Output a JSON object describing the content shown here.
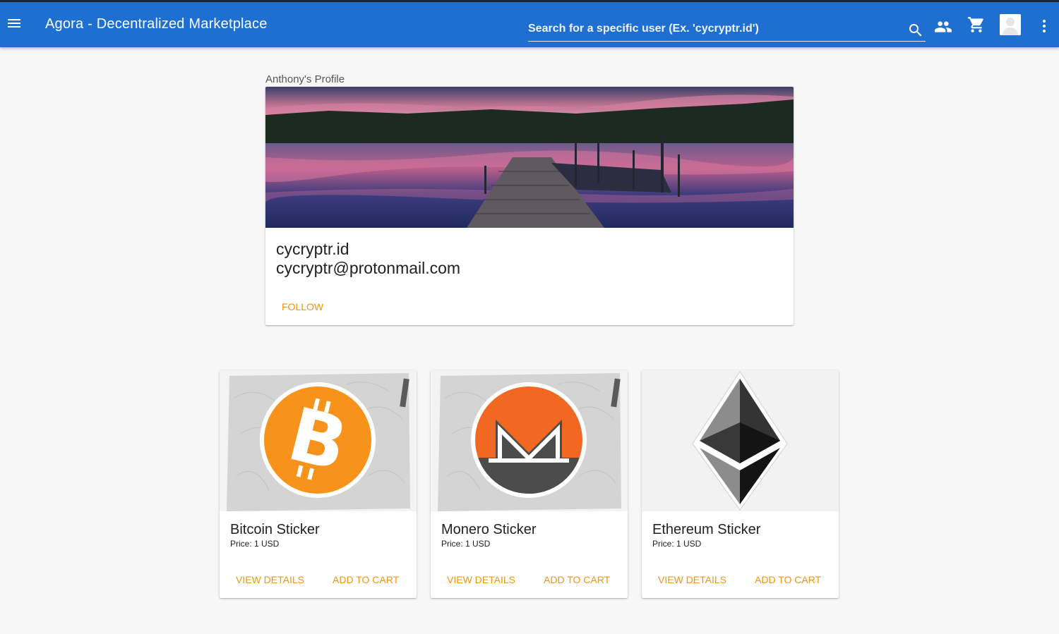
{
  "app": {
    "title": "Agora - Decentralized Marketplace"
  },
  "search": {
    "placeholder": "Search for a specific user (Ex. 'cycryptr.id')",
    "value": ""
  },
  "header_icons": [
    "menu-icon",
    "search-icon",
    "people-icon",
    "shopping-cart-icon",
    "avatar",
    "more-vert-icon"
  ],
  "profile": {
    "label": "Anthony's Profile",
    "username": "cycryptr.id",
    "email": "cycryptr@protonmail.com",
    "follow_label": "FOLLOW"
  },
  "products": [
    {
      "name": "Bitcoin Sticker",
      "price": "Price: 1 USD",
      "details_label": "VIEW DETAILS",
      "cart_label": "ADD TO CART",
      "icon": "bitcoin-logo"
    },
    {
      "name": "Monero Sticker",
      "price": "Price: 1 USD",
      "details_label": "VIEW DETAILS",
      "cart_label": "ADD TO CART",
      "icon": "monero-logo"
    },
    {
      "name": "Ethereum Sticker",
      "price": "Price: 1 USD",
      "details_label": "VIEW DETAILS",
      "cart_label": "ADD TO CART",
      "icon": "ethereum-logo"
    }
  ],
  "colors": {
    "app_bar": "#1e6fcf",
    "accent": "#f29412",
    "bitcoin": "#f7931a",
    "monero_orange": "#f26822",
    "monero_dark": "#4c4c4c",
    "background": "#f7f7f7"
  }
}
